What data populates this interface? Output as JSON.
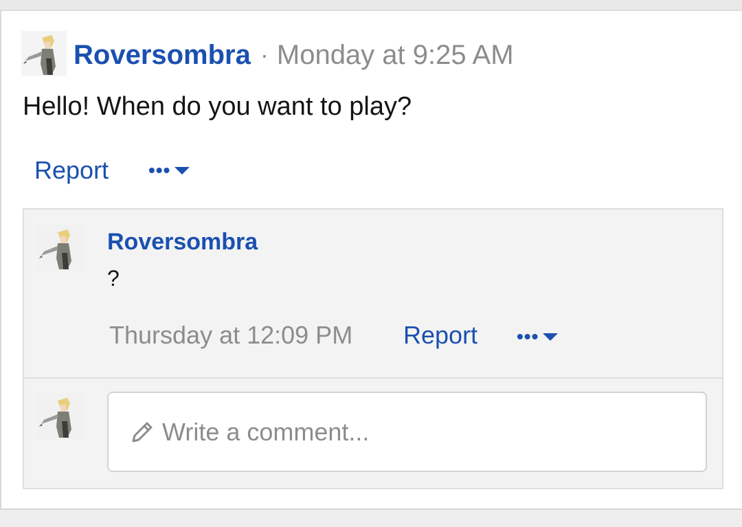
{
  "post": {
    "author": "Roversombra",
    "separator": "·",
    "timestamp": "Monday at 9:25 AM",
    "body": "Hello! When do you want to play?",
    "report_label": "Report",
    "more_label": "•••"
  },
  "comment": {
    "author": "Roversombra",
    "body": "?",
    "timestamp": "Thursday at 12:09 PM",
    "report_label": "Report",
    "more_label": "•••"
  },
  "composer": {
    "placeholder": "Write a comment..."
  },
  "colors": {
    "link": "#1a50b0",
    "muted": "#8c8c8c",
    "panel": "#f3f3f3"
  }
}
